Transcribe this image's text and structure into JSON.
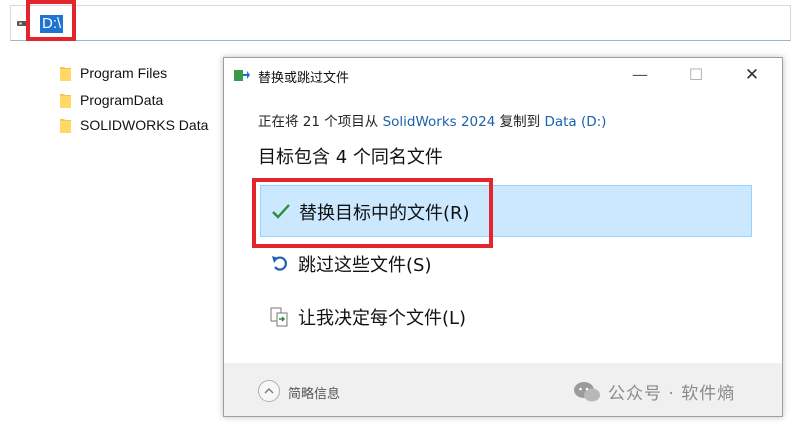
{
  "address_bar": {
    "path": "D:\\"
  },
  "folders": [
    {
      "name": "Program Files"
    },
    {
      "name": "ProgramData"
    },
    {
      "name": "SOLIDWORKS Data"
    }
  ],
  "dialog": {
    "title": "替换或跳过文件",
    "window_controls": {
      "minimize": "—",
      "maximize": "☐",
      "close": "✕"
    },
    "subline": {
      "prefix": "正在将 21 个项目从 ",
      "source": "SolidWorks 2024",
      "middle": " 复制到 ",
      "destination": "Data (D:)"
    },
    "heading": "目标包含 4 个同名文件",
    "options": [
      {
        "label": "替换目标中的文件(R)",
        "icon": "checkmark-icon",
        "selected": true
      },
      {
        "label": "跳过这些文件(S)",
        "icon": "undo-arrow-icon",
        "selected": false
      },
      {
        "label": "让我决定每个文件(L)",
        "icon": "compare-files-icon",
        "selected": false
      }
    ],
    "footer": {
      "details_label": "简略信息"
    }
  },
  "watermark": {
    "text": "公众号 · 软件熵"
  },
  "colors": {
    "selection": "#cce8ff",
    "link": "#1a62ad",
    "highlight_box": "#e3262e",
    "check": "#2e8b3d"
  }
}
